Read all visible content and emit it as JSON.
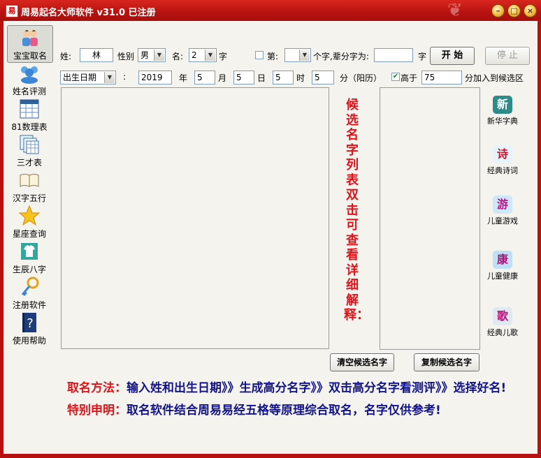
{
  "window": {
    "title": "周易起名大师软件 v31.0 已注册",
    "app_icon": "易",
    "min": "–",
    "max": "□",
    "close": "×"
  },
  "nav": [
    {
      "name": "nav-baby-naming",
      "label": "宝宝取名",
      "icon": "baby-icon"
    },
    {
      "name": "nav-name-evaluation",
      "label": "姓名评测",
      "icon": "people-icon"
    },
    {
      "name": "nav-81-numerology",
      "label": "81数理表",
      "icon": "table-icon"
    },
    {
      "name": "nav-sancai",
      "label": "三才表",
      "icon": "stacked-sheets-icon"
    },
    {
      "name": "nav-hanzi-wuxing",
      "label": "汉字五行",
      "icon": "open-book-icon"
    },
    {
      "name": "nav-constellation",
      "label": "星座查询",
      "icon": "star-icon"
    },
    {
      "name": "nav-bazi",
      "label": "生辰八字",
      "icon": "shirt-icon"
    },
    {
      "name": "nav-register",
      "label": "注册软件",
      "icon": "key-icon"
    },
    {
      "name": "nav-help",
      "label": "使用帮助",
      "icon": "help-book-icon"
    }
  ],
  "form": {
    "surname_label": "姓:",
    "surname_value": "林",
    "gender_label": "性别",
    "gender_value": "男",
    "name_label": "名:",
    "name_count": "2",
    "name_unit": "字",
    "pos_label": "第:",
    "pos_value": "",
    "generation_label": "个字,辈分字为:",
    "generation_value": "",
    "generation_unit": "字",
    "start_button": "开  始",
    "stop_button": "停  止",
    "date_type": "出生日期",
    "colon": ":",
    "year": "2019",
    "year_unit": "年",
    "month": "5",
    "month_unit": "月",
    "day": "5",
    "day_unit": "日",
    "hour": "5",
    "hour_unit": "时",
    "minute": "5",
    "minute_unit": "分（阳历）",
    "above_checked": true,
    "above_label": "高于",
    "above_value": "75",
    "above_suffix": "分加入到候选区"
  },
  "candidate_hint": "候选名字列表双击可查看详细解释：",
  "buttons": {
    "clear": "清空候选名字",
    "copy": "复制候选名字"
  },
  "side_tools": [
    {
      "name": "xinhua-dictionary",
      "glyph": "新",
      "label": "新华字典",
      "bg": "#2f8a8a",
      "fg": "#ffffff"
    },
    {
      "name": "classic-poems",
      "glyph": "诗",
      "label": "经典诗词",
      "bg": "#e6f3fb",
      "fg": "#d0102a"
    },
    {
      "name": "kids-games",
      "glyph": "游",
      "label": "儿童游戏",
      "bg": "#cfe8f8",
      "fg": "#c0108a"
    },
    {
      "name": "kids-health",
      "glyph": "康",
      "label": "儿童健康",
      "bg": "#bfe0f5",
      "fg": "#b0107a"
    },
    {
      "name": "classic-songs",
      "glyph": "歌",
      "label": "经典儿歌",
      "bg": "#dfe9f0",
      "fg": "#c0107a"
    }
  ],
  "method": {
    "line1_key": "取名方法：",
    "line1_text": "输入姓和出生日期》》生成高分名字》》双击高分名字看测评》》选择好名!",
    "line2_key": "特别申明：",
    "line2_text": "取名软件结合周易易经五格等原理综合取名，名字仅供参考!"
  },
  "colors": {
    "title_red": "#b7120f",
    "accent_red": "#e0121a",
    "navy": "#13148a"
  }
}
